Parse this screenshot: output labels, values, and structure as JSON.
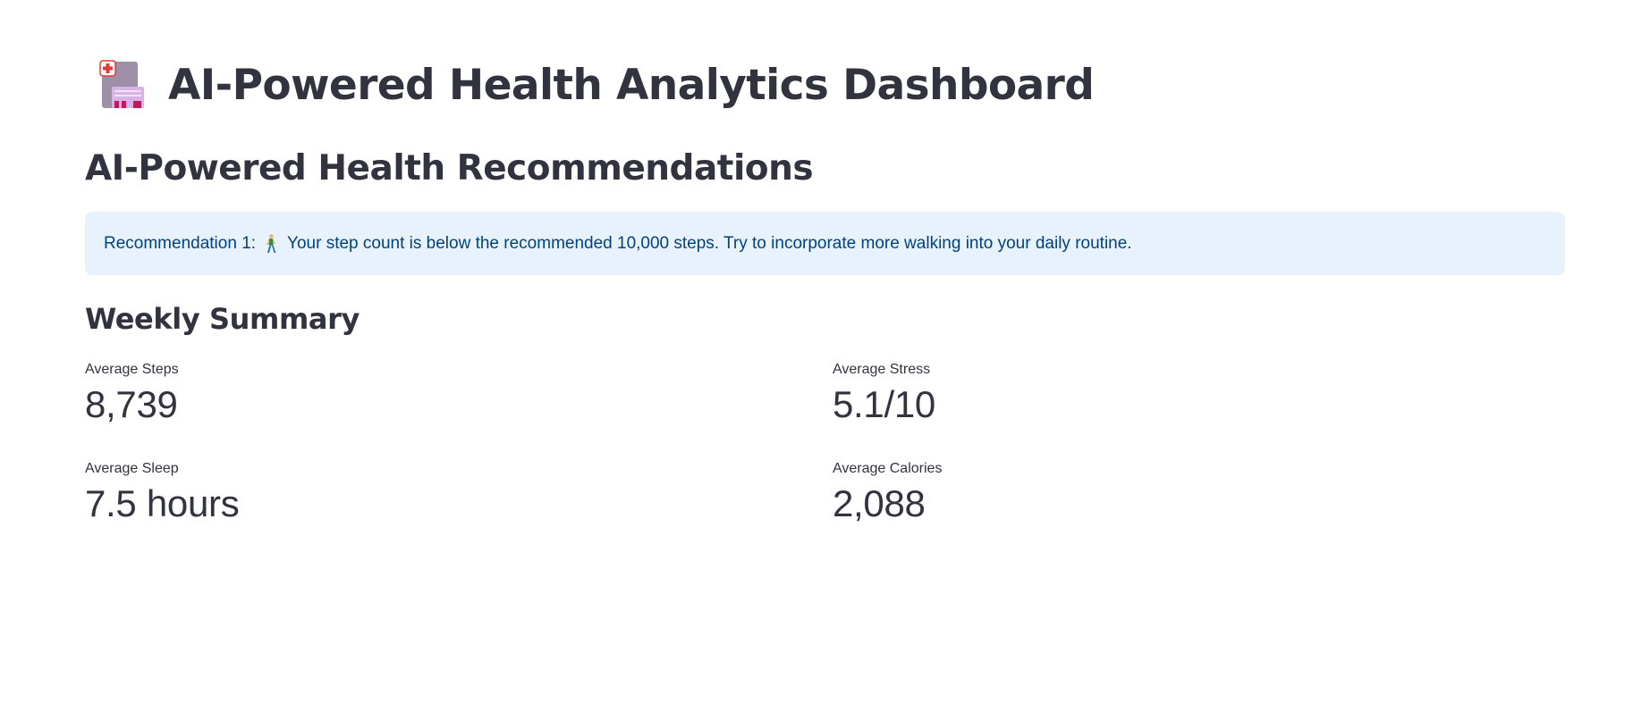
{
  "page": {
    "title": "AI-Powered Health Analytics Dashboard",
    "title_icon": "hospital-icon"
  },
  "recommendations": {
    "heading": "AI-Powered Health Recommendations",
    "items": [
      {
        "prefix": "Recommendation 1:",
        "icon": "walking-person-icon",
        "text": "Your step count is below the recommended 10,000 steps. Try to incorporate more walking into your daily routine."
      }
    ]
  },
  "summary": {
    "heading": "Weekly Summary",
    "metrics": [
      {
        "label": "Average Steps",
        "value": "8,739"
      },
      {
        "label": "Average Stress",
        "value": "5.1/10"
      },
      {
        "label": "Average Sleep",
        "value": "7.5 hours"
      },
      {
        "label": "Average Calories",
        "value": "2,088"
      }
    ]
  },
  "colors": {
    "text": "#31333f",
    "info_background": "#e8f2fc",
    "info_text": "#004280"
  }
}
